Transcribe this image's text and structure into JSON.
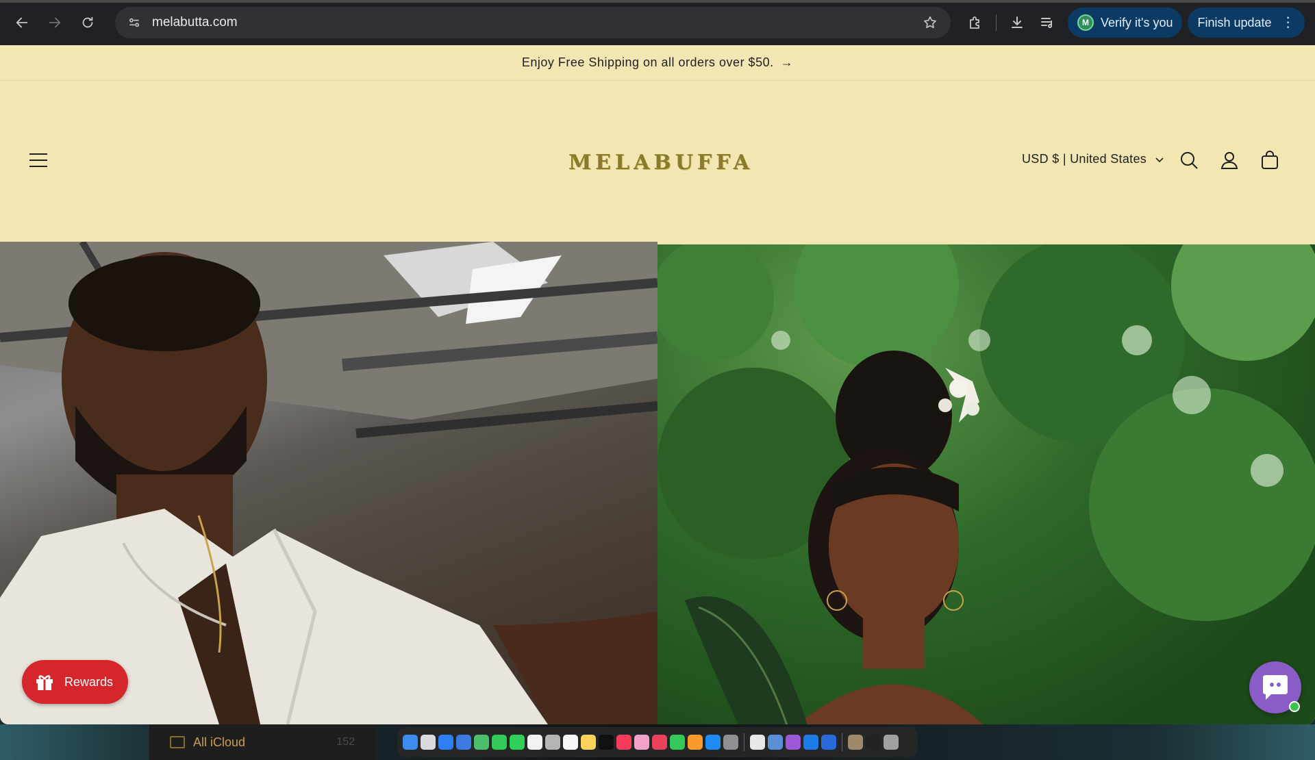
{
  "browser": {
    "url": "melabutta.com",
    "verify_label": "Verify it's you",
    "verify_avatar": "M",
    "update_label": "Finish update",
    "icons": [
      "back-icon",
      "forward-icon",
      "reload-icon",
      "site-info-icon",
      "bookmark-star-icon",
      "extensions-icon",
      "download-icon",
      "media-control-icon",
      "kebab-menu-icon"
    ]
  },
  "announcement": {
    "text": "Enjoy Free Shipping on all orders over $50.",
    "arrow": "→"
  },
  "header": {
    "logo_text": "MELABUFFA",
    "currency_label": "USD $ | United States",
    "icons": [
      "hamburger-menu-icon",
      "search-icon",
      "account-icon",
      "cart-icon"
    ]
  },
  "hero": {
    "left_image": "man-in-white-shirt-photo",
    "right_image": "woman-in-greenery-photo"
  },
  "rewards": {
    "label": "Rewards"
  },
  "chat": {
    "status_color": "#3ac24a"
  },
  "desktop": {
    "finder_label": "All iCloud",
    "finder_count": "152"
  },
  "colors": {
    "page_bg": "#f2e6b3",
    "rewards_red": "#d4262b",
    "chat_purple": "#8a5cc7",
    "pill_blue": "#0b3a64"
  }
}
